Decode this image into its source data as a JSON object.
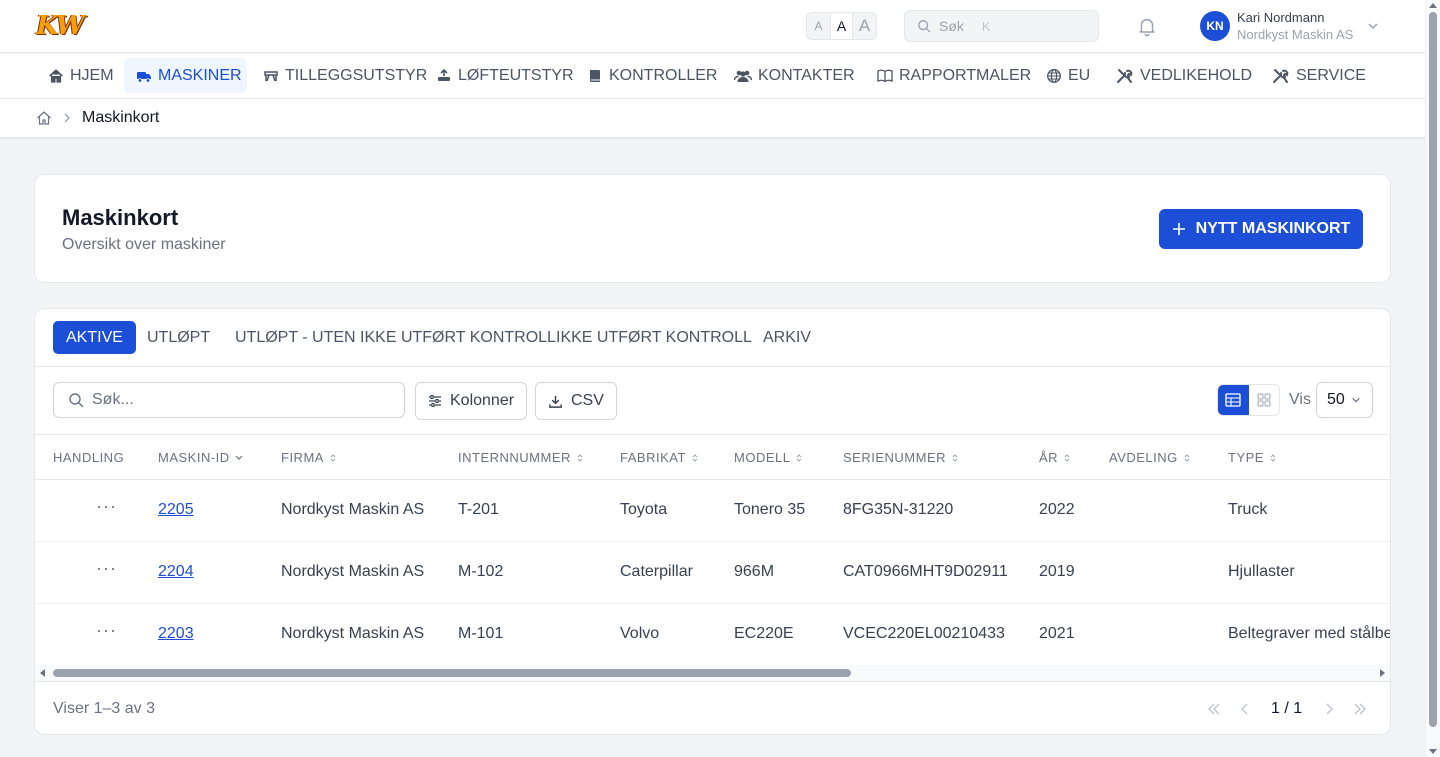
{
  "brand": {
    "logo_text": "KW",
    "accent": "#1d4ed8",
    "logo_color": "#f59e0b"
  },
  "topbar": {
    "font_sizes": [
      "A",
      "A",
      "A"
    ],
    "search_placeholder": "Søk",
    "search_shortcut": "K",
    "user": {
      "initials": "KN",
      "name": "Kari Nordmann",
      "org": "Nordkyst Maskin AS"
    }
  },
  "nav": [
    {
      "label": "HJEM",
      "icon": "home-icon",
      "active": false
    },
    {
      "label": "MASKINER",
      "icon": "truck-icon",
      "active": true
    },
    {
      "label": "TILLEGGSUTSTYR",
      "icon": "attachment-icon",
      "active": false
    },
    {
      "label": "LØFTEUTSTYR",
      "icon": "lifting-icon",
      "active": false
    },
    {
      "label": "KONTROLLER",
      "icon": "book-icon",
      "active": false
    },
    {
      "label": "KONTAKTER",
      "icon": "users-icon",
      "active": false
    },
    {
      "label": "RAPPORTMALER",
      "icon": "open-book-icon",
      "active": false
    },
    {
      "label": "EU",
      "icon": "globe-icon",
      "active": false
    },
    {
      "label": "VEDLIKEHOLD",
      "icon": "tools-icon",
      "active": false
    },
    {
      "label": "SERVICE",
      "icon": "wrench-icon",
      "active": false
    }
  ],
  "breadcrumb": {
    "current": "Maskinkort"
  },
  "header": {
    "title": "Maskinkort",
    "subtitle": "Oversikt over maskiner",
    "new_button": "NYTT MASKINKORT"
  },
  "tabs": [
    {
      "label": "AKTIVE",
      "active": true
    },
    {
      "label": "UTLØPT",
      "active": false
    },
    {
      "label": "UTLØPT - UTEN IKKE UTFØRT KONTROLL",
      "active": false
    },
    {
      "label": "IKKE UTFØRT KONTROLL",
      "active": false
    },
    {
      "label": "ARKIV",
      "active": false
    }
  ],
  "toolbar": {
    "search_placeholder": "Søk...",
    "columns_label": "Kolonner",
    "csv_label": "CSV",
    "view_label": "Vis",
    "page_size": "50"
  },
  "table": {
    "columns": [
      "HANDLING",
      "MASKIN-ID",
      "FIRMA",
      "INTERNNUMMER",
      "FABRIKAT",
      "MODELL",
      "SERIENUMMER",
      "ÅR",
      "AVDELING",
      "TYPE"
    ],
    "sorted_column": "MASKIN-ID",
    "rows": [
      {
        "id": "2205",
        "firma": "Nordkyst Maskin AS",
        "internnummer": "T-201",
        "fabrikat": "Toyota",
        "modell": "Tonero 35",
        "serienummer": "8FG35N-31220",
        "ar": "2022",
        "avdeling": "",
        "type": "Truck"
      },
      {
        "id": "2204",
        "firma": "Nordkyst Maskin AS",
        "internnummer": "M-102",
        "fabrikat": "Caterpillar",
        "modell": "966M",
        "serienummer": "CAT0966MHT9D02911",
        "ar": "2019",
        "avdeling": "",
        "type": "Hjullaster"
      },
      {
        "id": "2203",
        "firma": "Nordkyst Maskin AS",
        "internnummer": "M-101",
        "fabrikat": "Volvo",
        "modell": "EC220E",
        "serienummer": "VCEC220EL00210433",
        "ar": "2021",
        "avdeling": "",
        "type": "Beltegraver med stålbe"
      }
    ]
  },
  "footer": {
    "info": "Viser 1–3 av 3",
    "pagination": "1 / 1"
  }
}
